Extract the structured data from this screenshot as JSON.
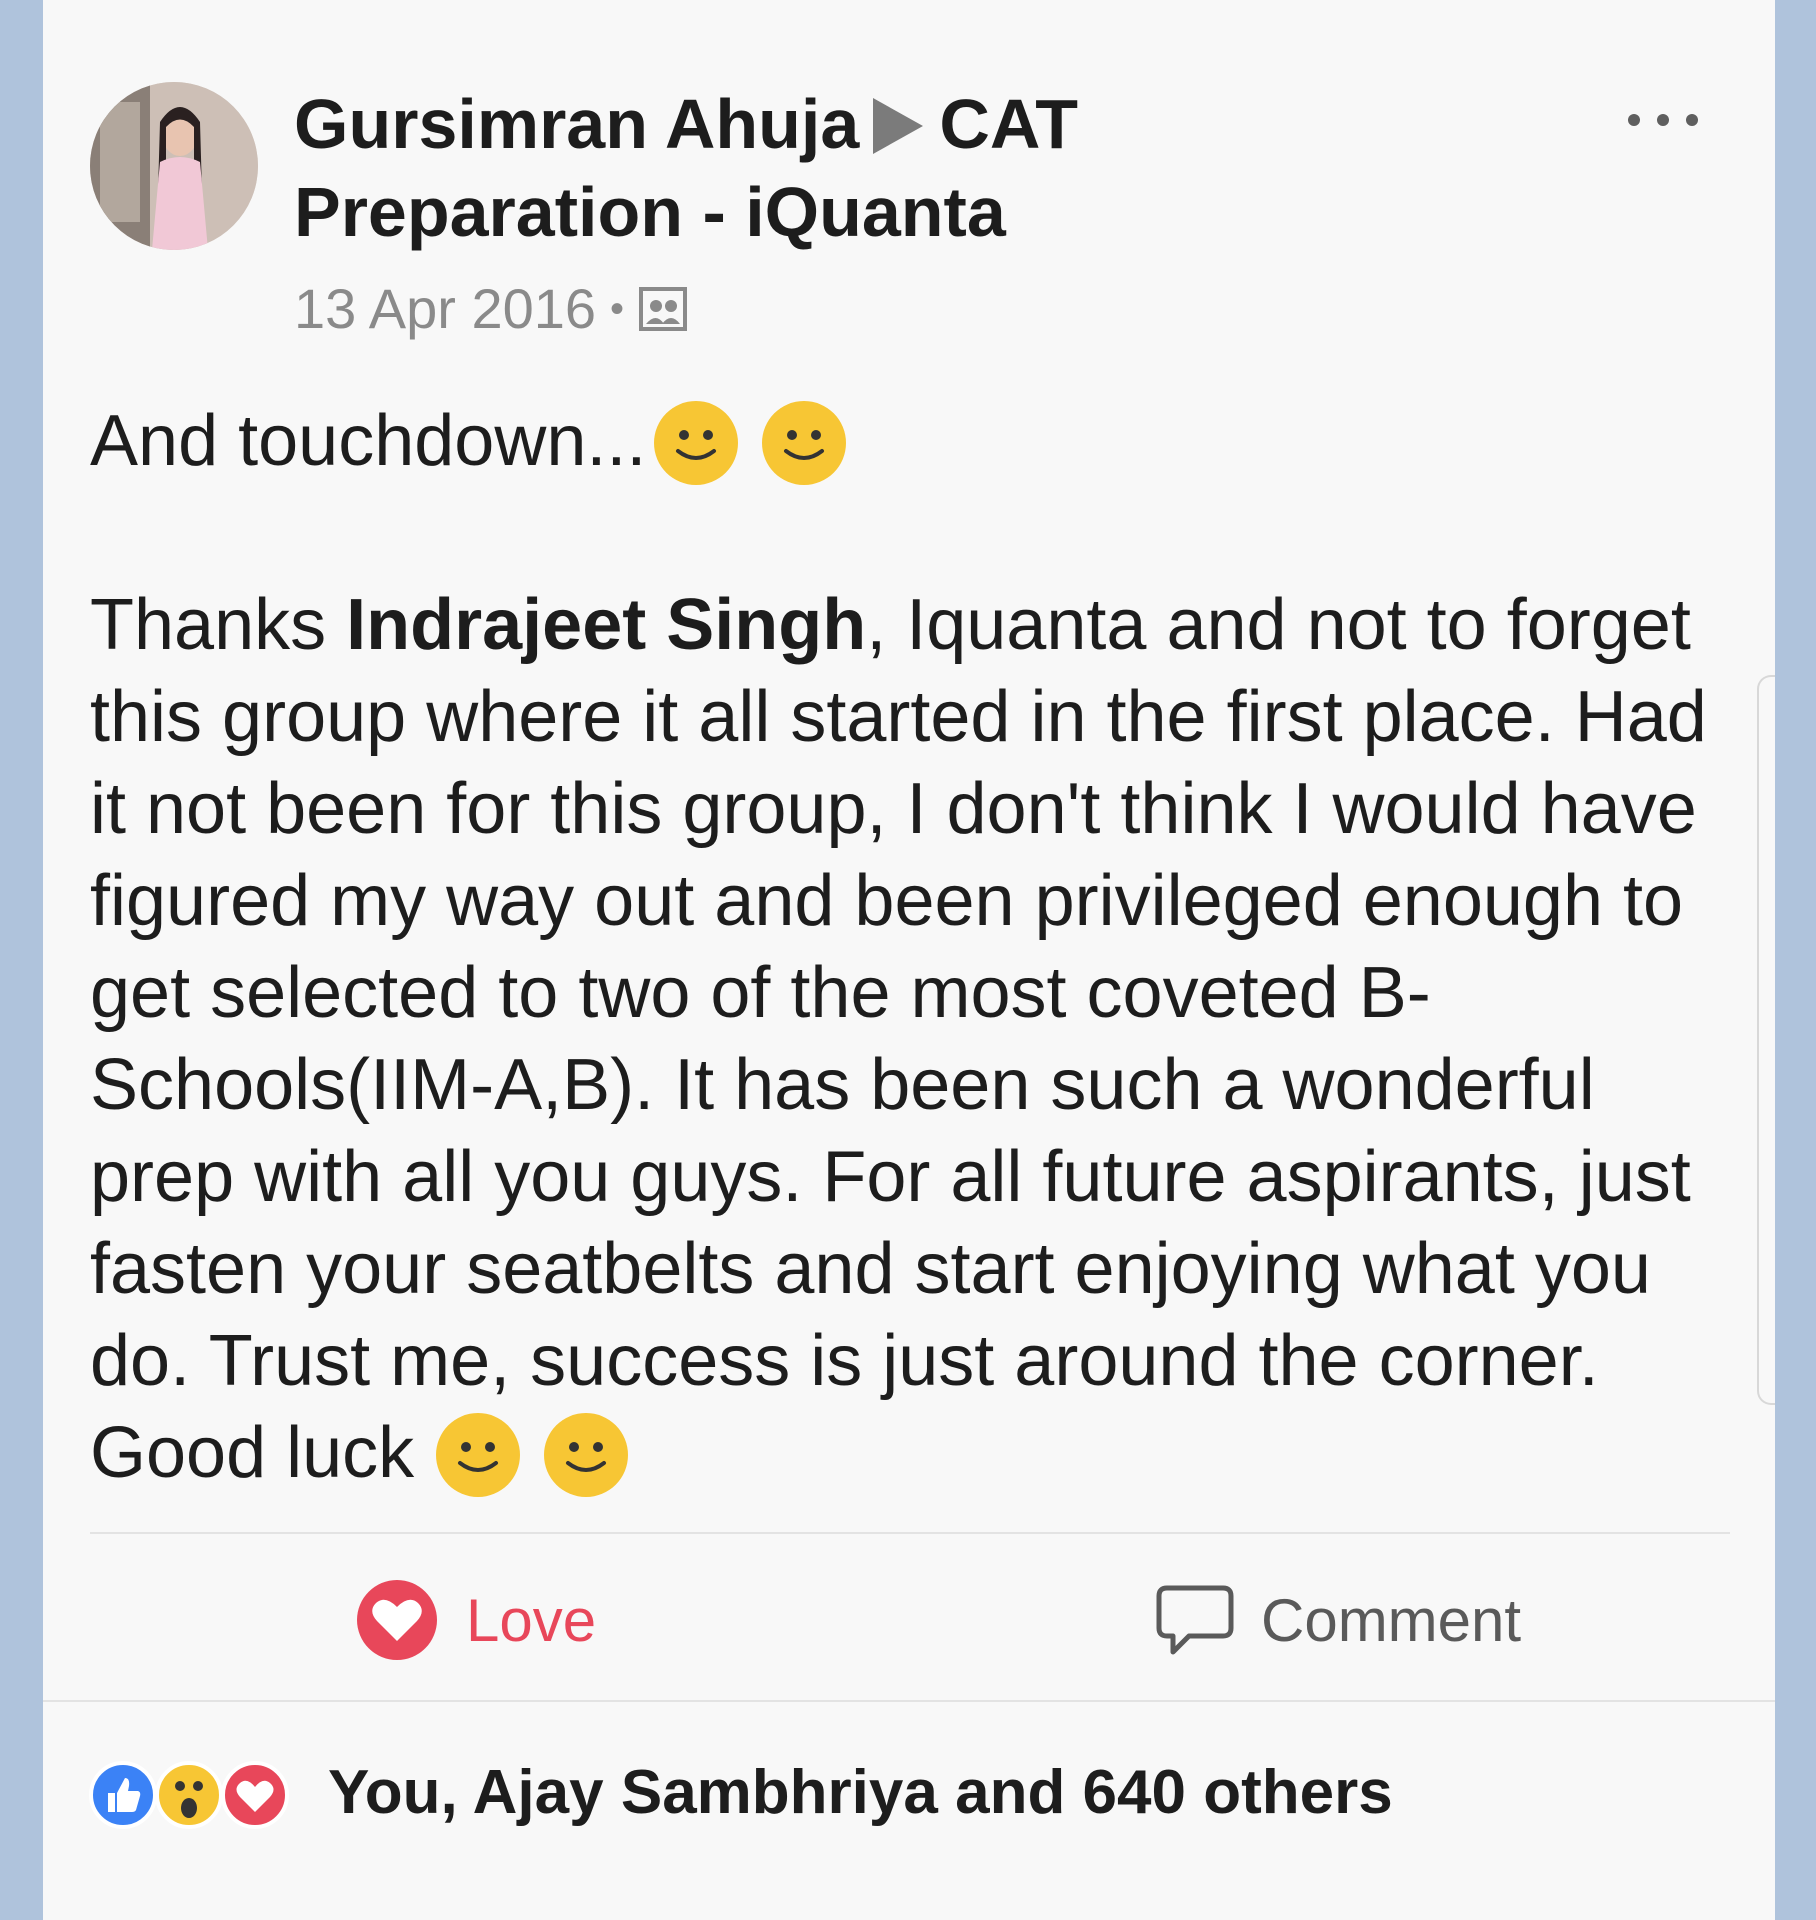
{
  "post": {
    "author": "Gursimran Ahuja",
    "group_line1": "CAT",
    "group_line2": "Preparation - iQuanta",
    "date": "13 Apr 2016",
    "separator": "•",
    "privacy_icon": "public-group-icon",
    "body": {
      "first_line": "And touchdown...",
      "thanks_prefix": "Thanks ",
      "mention": "Indrajeet Singh",
      "paragraph": ", Iquanta and not to forget this group where it all started in the first place. Had it not been for this group, I don't think I would have figured my way out and been privileged enough to get selected to two of the most coveted B-Schools(IIM-A,B). It has been such a wonderful prep with all you guys. For all future aspirants, just fasten your seatbelts and start enjoying what you do. Trust me, success is just around the corner.",
      "closing": "Good luck"
    }
  },
  "actions": {
    "love_label": "Love",
    "comment_label": "Comment"
  },
  "reactions": {
    "icons": [
      "like-icon",
      "wow-icon",
      "love-icon"
    ],
    "summary": "You, Ajay Sambhriya and 640 others"
  },
  "colors": {
    "love": "#e8475a",
    "like": "#3b82f6",
    "emoji": "#f7c634",
    "background": "#afc3dc"
  }
}
